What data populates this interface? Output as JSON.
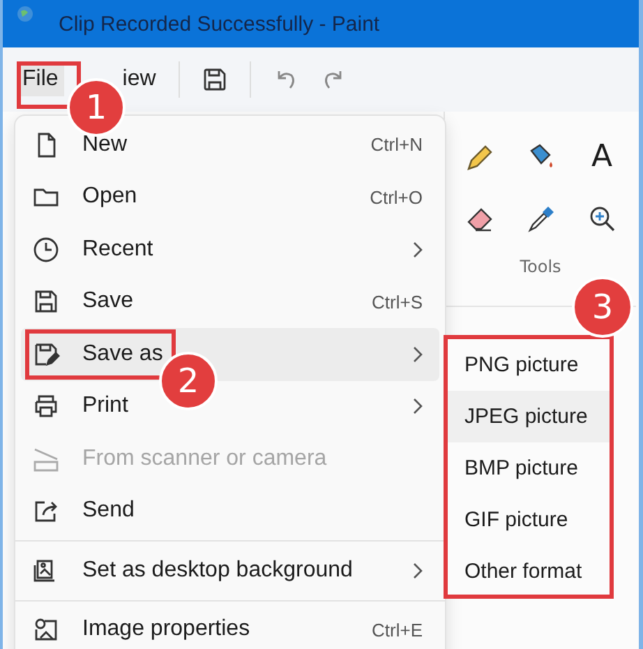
{
  "window": {
    "title": "Clip Recorded Successfully - Paint"
  },
  "toolbar": {
    "menus": [
      {
        "label": "File",
        "selected": true
      },
      {
        "label": "iew",
        "selected": false
      }
    ]
  },
  "tools": {
    "text_glyph": "A",
    "label": "Tools"
  },
  "file_menu": {
    "groups": [
      [
        {
          "label": "New",
          "shortcut": "Ctrl+N",
          "submenu": false,
          "disabled": false,
          "highlighted": false
        },
        {
          "label": "Open",
          "shortcut": "Ctrl+O",
          "submenu": false,
          "disabled": false,
          "highlighted": false
        },
        {
          "label": "Recent",
          "submenu": true,
          "disabled": false,
          "highlighted": false
        },
        {
          "label": "Save",
          "shortcut": "Ctrl+S",
          "submenu": false,
          "disabled": false,
          "highlighted": false
        },
        {
          "label": "Save as",
          "submenu": true,
          "disabled": false,
          "highlighted": true
        },
        {
          "label": "Print",
          "submenu": true,
          "disabled": false,
          "highlighted": false
        },
        {
          "label": "From scanner or camera",
          "submenu": false,
          "disabled": true,
          "highlighted": false
        },
        {
          "label": "Send",
          "submenu": false,
          "disabled": false,
          "highlighted": false
        }
      ],
      [
        {
          "label": "Set as desktop background",
          "submenu": true,
          "disabled": false,
          "highlighted": false
        }
      ],
      [
        {
          "label": "Image properties",
          "shortcut": "Ctrl+E",
          "submenu": false,
          "disabled": false,
          "highlighted": false
        }
      ]
    ]
  },
  "save_as_menu": {
    "items": [
      {
        "label": "PNG picture",
        "highlighted": false
      },
      {
        "label": "JPEG picture",
        "highlighted": true
      },
      {
        "label": "BMP picture",
        "highlighted": false
      },
      {
        "label": "GIF picture",
        "highlighted": false
      },
      {
        "label": "Other format",
        "highlighted": false
      }
    ]
  },
  "callouts": [
    {
      "number": "1"
    },
    {
      "number": "2"
    },
    {
      "number": "3"
    }
  ]
}
